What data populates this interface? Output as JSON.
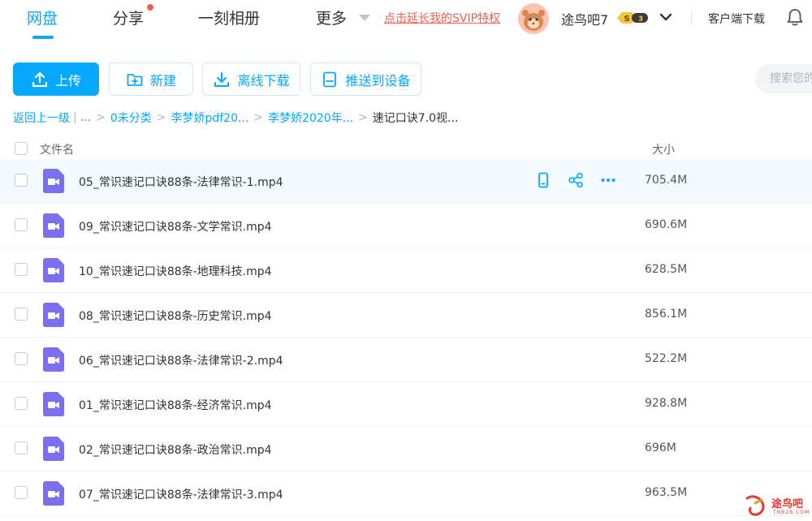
{
  "nav": {
    "items": [
      {
        "label": "网盘",
        "active": true
      },
      {
        "label": "分享",
        "has_dot": true
      },
      {
        "label": "一刻相册"
      },
      {
        "label": "更多"
      }
    ],
    "svip_link": "点击延长我的SVIP特权",
    "username": "途鸟吧7",
    "level_badge": "S 3",
    "client_download": "客户端下载",
    "accent_color": "#06a7ff",
    "alert_color": "#f25d4e"
  },
  "toolbar": {
    "upload_label": "上传",
    "new_label": "新建",
    "offline_download_label": "离线下载",
    "push_to_device_label": "推送到设备",
    "search_placeholder": "搜索您的文件"
  },
  "breadcrumb": {
    "back": "返回上一级",
    "ellipsis": "...",
    "items": [
      "0未分类",
      "李梦娇pdf20...",
      "李梦娇2020年..."
    ],
    "current": "速记口诀7.0视..."
  },
  "table": {
    "headers": {
      "name": "文件名",
      "size": "大小"
    },
    "rows": [
      {
        "name": "05_常识速记口诀88条-法律常识-1.mp4",
        "size": "705.4M",
        "hovered": true
      },
      {
        "name": "09_常识速记口诀88条-文学常识.mp4",
        "size": "690.6M"
      },
      {
        "name": "10_常识速记口诀88条-地理科技.mp4",
        "size": "628.5M"
      },
      {
        "name": "08_常识速记口诀88条-历史常识.mp4",
        "size": "856.1M"
      },
      {
        "name": "06_常识速记口诀88条-法律常识-2.mp4",
        "size": "522.2M"
      },
      {
        "name": "01_常识速记口诀88条-经济常识.mp4",
        "size": "928.8M"
      },
      {
        "name": "02_常识速记口诀88条-政治常识.mp4",
        "size": "696M"
      },
      {
        "name": "07_常识速记口诀88条-法律常识-3.mp4",
        "size": "963.5M"
      }
    ],
    "row_icon": "video-file-icon",
    "row_actions": [
      "phone-icon",
      "share-icon",
      "more-icon"
    ]
  },
  "watermark": {
    "text": "途鸟吧",
    "sub": "TNB2B.COM"
  }
}
